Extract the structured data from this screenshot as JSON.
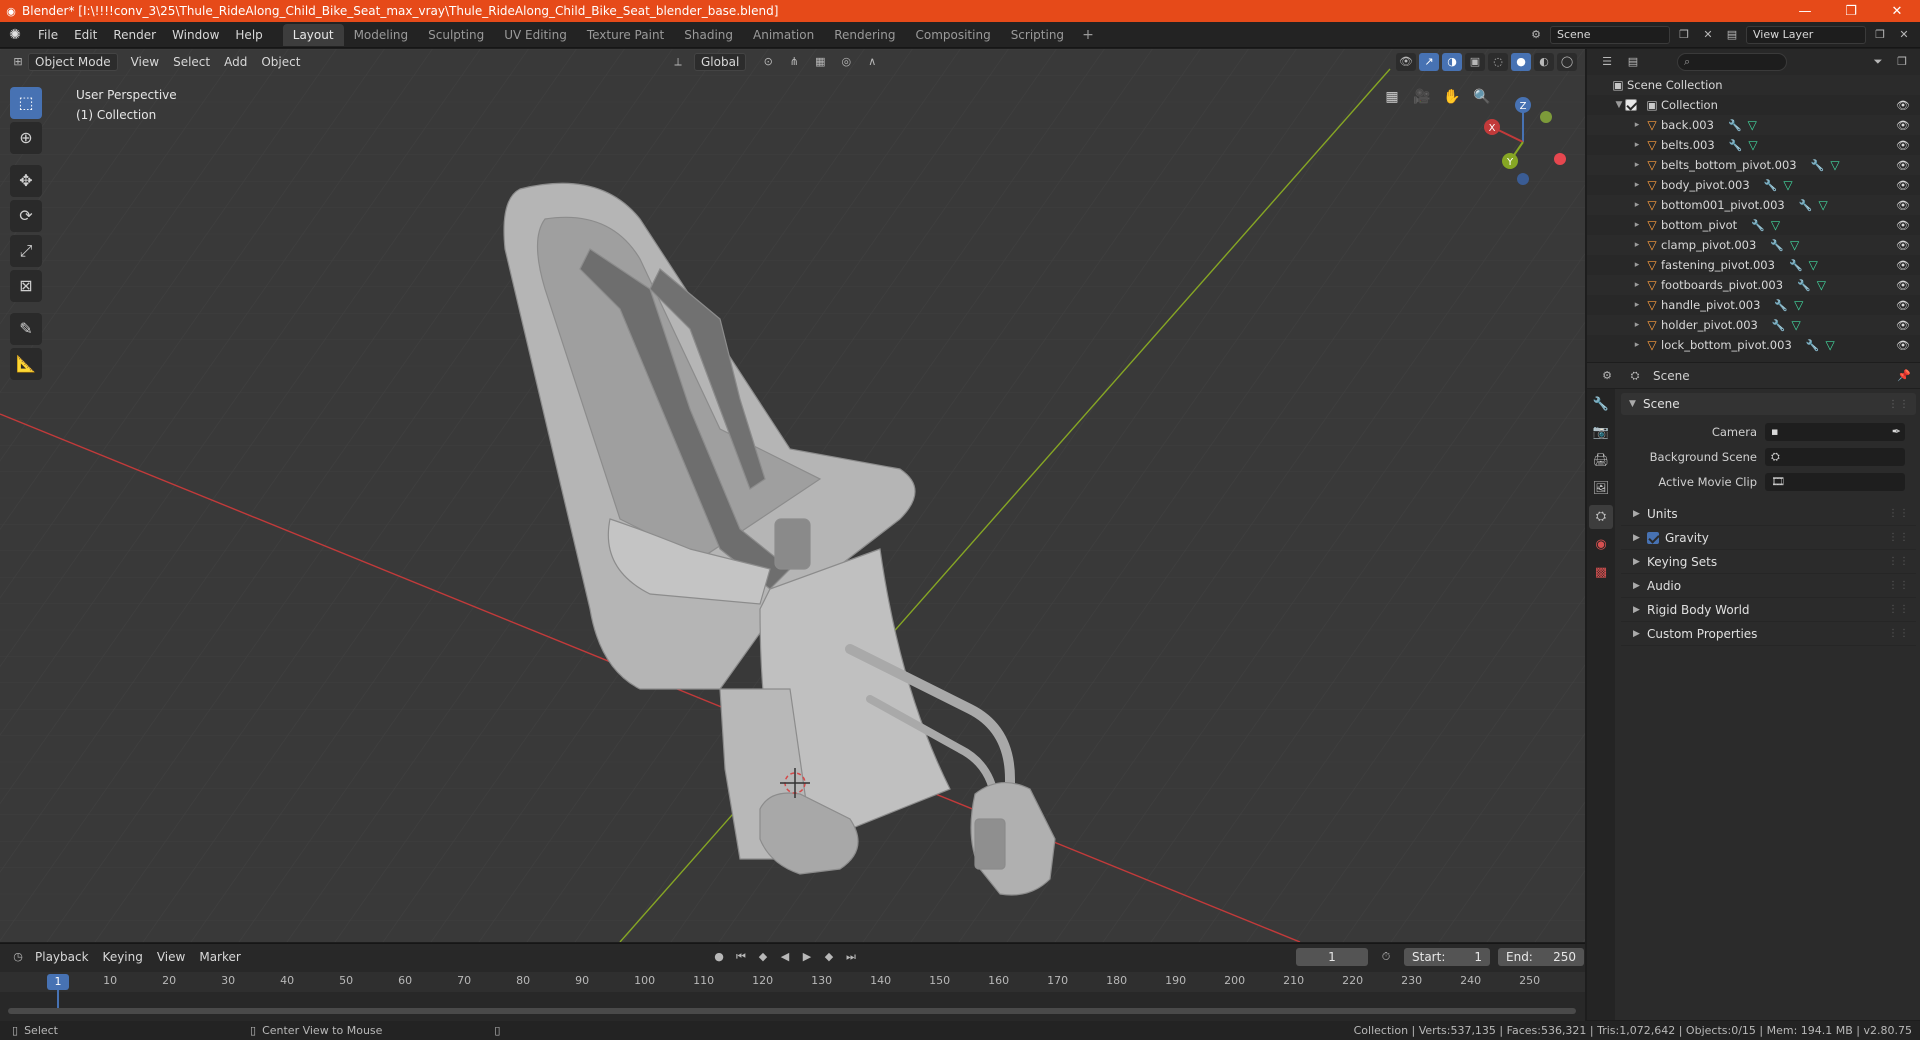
{
  "window": {
    "title": "Blender* [I:\\!!!!conv_3\\25\\Thule_RideAlong_Child_Bike_Seat_max_vray\\Thule_RideAlong_Child_Bike_Seat_blender_base.blend]",
    "minimize": "—",
    "maximize": "❐",
    "close": "✕"
  },
  "menubar": {
    "items": [
      "File",
      "Edit",
      "Render",
      "Window",
      "Help"
    ],
    "workspaces": [
      "Layout",
      "Modeling",
      "Sculpting",
      "UV Editing",
      "Texture Paint",
      "Shading",
      "Animation",
      "Rendering",
      "Compositing",
      "Scripting"
    ],
    "active_workspace": "Layout",
    "scene": "Scene",
    "view_layer": "View Layer"
  },
  "viewport": {
    "mode": "Object Mode",
    "menus": [
      "View",
      "Select",
      "Add",
      "Object"
    ],
    "transform_orientation": "Global",
    "info_line1": "User Perspective",
    "info_line2": "(1) Collection",
    "gizmo": {
      "x": "X",
      "y": "Y",
      "z": "Z"
    }
  },
  "timeline": {
    "menus": [
      "Playback",
      "Keying",
      "View",
      "Marker"
    ],
    "current_frame": "1",
    "start_label": "Start:",
    "start": "1",
    "end_label": "End:",
    "end": "250",
    "ticks": [
      "1",
      "10",
      "20",
      "30",
      "40",
      "50",
      "60",
      "70",
      "80",
      "90",
      "100",
      "110",
      "120",
      "130",
      "140",
      "150",
      "160",
      "170",
      "180",
      "190",
      "200",
      "210",
      "220",
      "230",
      "240",
      "250"
    ]
  },
  "statusbar": {
    "select": "Select",
    "center_view": "Center View to Mouse",
    "stats": "Collection | Verts:537,135 | Faces:536,321 | Tris:1,072,642 | Objects:0/15 | Mem: 194.1 MB | v2.80.75"
  },
  "outliner": {
    "root": "Scene Collection",
    "collection": "Collection",
    "objects": [
      "back.003",
      "belts.003",
      "belts_bottom_pivot.003",
      "body_pivot.003",
      "bottom001_pivot.003",
      "bottom_pivot",
      "clamp_pivot.003",
      "fastening_pivot.003",
      "footboards_pivot.003",
      "handle_pivot.003",
      "holder_pivot.003",
      "lock_bottom_pivot.003"
    ]
  },
  "properties": {
    "header": "Scene",
    "panel": "Scene",
    "fields": [
      {
        "label": "Camera",
        "value": ""
      },
      {
        "label": "Background Scene",
        "value": ""
      },
      {
        "label": "Active Movie Clip",
        "value": ""
      }
    ],
    "sections": [
      "Units",
      "Gravity",
      "Keying Sets",
      "Audio",
      "Rigid Body World",
      "Custom Properties"
    ]
  },
  "colors": {
    "titlebar": "#e64a19",
    "accent": "#4772b3",
    "viewport_bg": "#393939",
    "x_axis": "#c23a3a",
    "y_axis": "#86a624",
    "mesh_icon": "#ff9f40"
  }
}
